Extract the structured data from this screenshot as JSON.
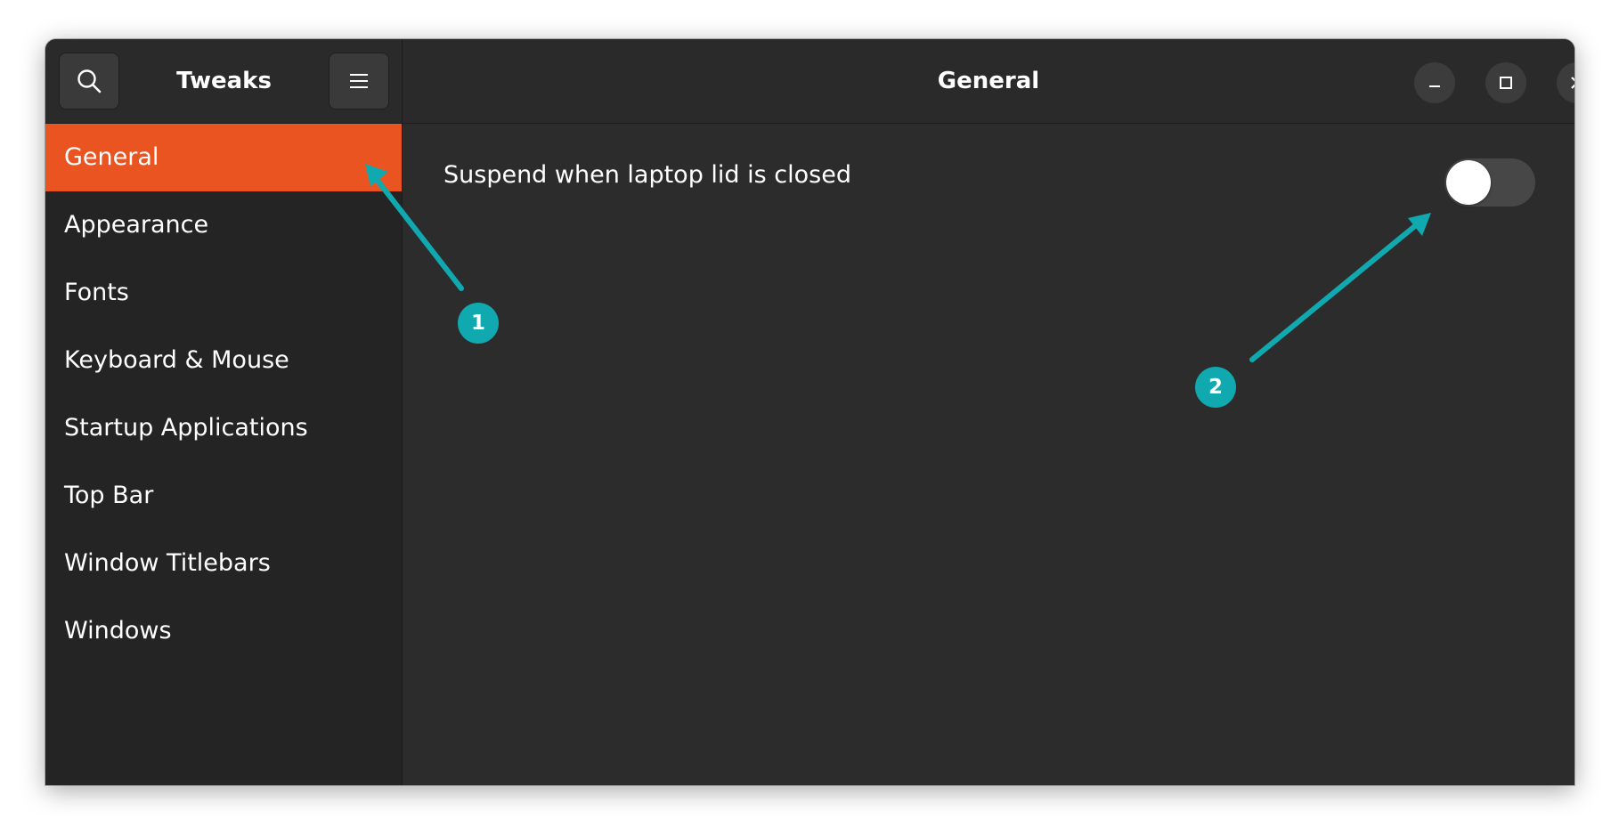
{
  "app": {
    "title": "Tweaks"
  },
  "header": {
    "page_title": "General",
    "search_icon": "search-icon",
    "menu_icon": "hamburger-menu-icon",
    "window_controls": [
      "minimize-icon",
      "maximize-icon",
      "close-icon"
    ]
  },
  "sidebar": {
    "items": [
      {
        "label": "General",
        "active": true
      },
      {
        "label": "Appearance",
        "active": false
      },
      {
        "label": "Fonts",
        "active": false
      },
      {
        "label": "Keyboard & Mouse",
        "active": false
      },
      {
        "label": "Startup Applications",
        "active": false
      },
      {
        "label": "Top Bar",
        "active": false
      },
      {
        "label": "Window Titlebars",
        "active": false
      },
      {
        "label": "Windows",
        "active": false
      }
    ]
  },
  "settings": [
    {
      "label": "Suspend when laptop lid is closed",
      "enabled": false
    }
  ],
  "annotations": [
    {
      "number": "1"
    },
    {
      "number": "2"
    }
  ],
  "colors": {
    "accent": "#e95420",
    "annotation": "#11a9b0",
    "window_bg": "#2c2c2c",
    "sidebar_bg": "#242424"
  }
}
